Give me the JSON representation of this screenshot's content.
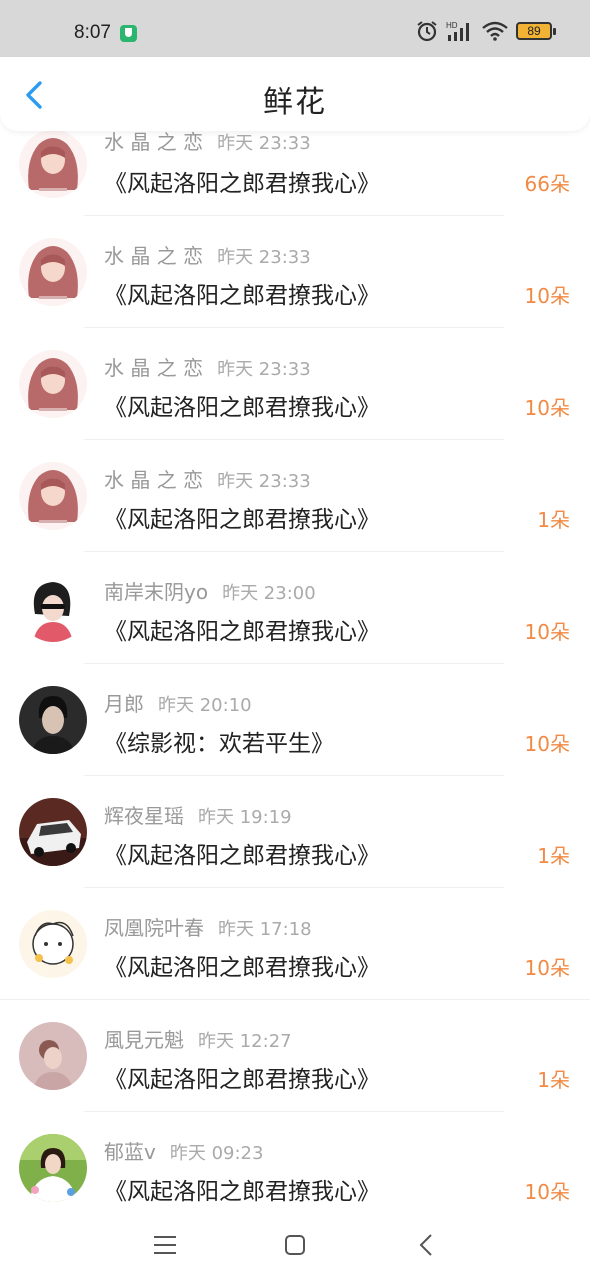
{
  "status_bar": {
    "time": "8:07",
    "battery": "89",
    "icons": [
      "vpn-shield-icon",
      "alarm-icon",
      "signal-icon",
      "wifi-icon",
      "battery-icon"
    ]
  },
  "header": {
    "title": "鲜花",
    "back_icon": "chevron-left-icon",
    "accent_color": "#2d9cf0"
  },
  "colors": {
    "count": "#f08a44",
    "name": "#999999",
    "book": "#222222"
  },
  "items": [
    {
      "user": "水 晶 之 恋",
      "time": "昨天 23:33",
      "book": "《风起洛阳之郎君撩我心》",
      "count": "66朵"
    },
    {
      "user": "水 晶 之 恋",
      "time": "昨天 23:33",
      "book": "《风起洛阳之郎君撩我心》",
      "count": "10朵"
    },
    {
      "user": "水 晶 之 恋",
      "time": "昨天 23:33",
      "book": "《风起洛阳之郎君撩我心》",
      "count": "10朵"
    },
    {
      "user": "水 晶 之 恋",
      "time": "昨天 23:33",
      "book": "《风起洛阳之郎君撩我心》",
      "count": "1朵"
    },
    {
      "user": "南岸末阴yo",
      "time": "昨天 23:00",
      "book": "《风起洛阳之郎君撩我心》",
      "count": "10朵"
    },
    {
      "user": "月郎",
      "time": "昨天 20:10",
      "book": "《综影视：欢若平生》",
      "count": "10朵"
    },
    {
      "user": "辉夜星瑶",
      "time": "昨天 19:19",
      "book": "《风起洛阳之郎君撩我心》",
      "count": "1朵"
    },
    {
      "user": "凤凰院叶春",
      "time": "昨天 17:18",
      "book": "《风起洛阳之郎君撩我心》",
      "count": "10朵"
    },
    {
      "user": "風見元魁",
      "time": "昨天 12:27",
      "book": "《风起洛阳之郎君撩我心》",
      "count": "1朵"
    },
    {
      "user": "郁蓝v",
      "time": "昨天 09:23",
      "book": "《风起洛阳之郎君撩我心》",
      "count": "10朵"
    }
  ],
  "nav_bar": {
    "icons": [
      "menu-icon",
      "home-icon",
      "back-icon"
    ]
  }
}
